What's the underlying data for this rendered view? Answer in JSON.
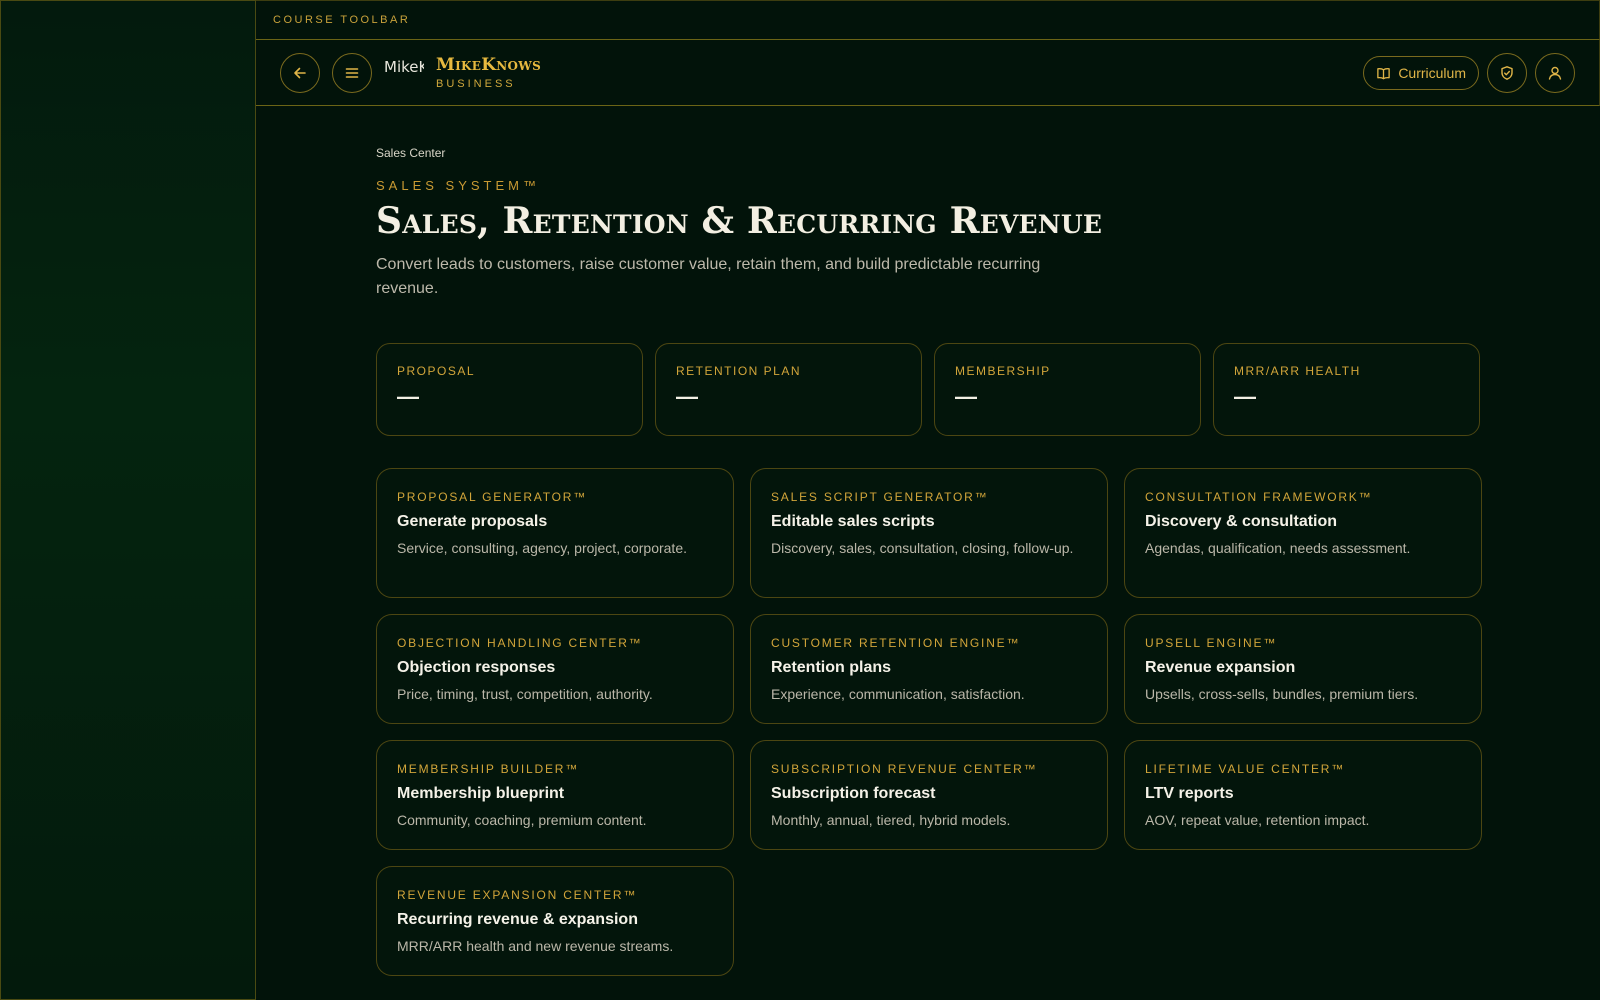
{
  "toolbar": {
    "label": "COURSE TOOLBAR"
  },
  "header": {
    "logo_alt": "MikeKnows",
    "brand_name": "MikeKnows",
    "brand_sub": "BUSINESS",
    "curriculum_label": "Curriculum",
    "icons": [
      "arrow-left-icon",
      "menu-icon",
      "book-icon",
      "shield-check-icon",
      "user-icon"
    ]
  },
  "page": {
    "breadcrumb": "Sales Center",
    "eyebrow": "SALES SYSTEM™",
    "title": "Sales, Retention & Recurring Revenue",
    "description": "Convert leads to customers, raise customer value, retain them, and build predictable recurring revenue."
  },
  "stats": [
    {
      "label": "PROPOSAL",
      "value": "—"
    },
    {
      "label": "RETENTION PLAN",
      "value": "—"
    },
    {
      "label": "MEMBERSHIP",
      "value": "—"
    },
    {
      "label": "MRR/ARR HEALTH",
      "value": "—"
    }
  ],
  "tools": [
    {
      "eyebrow": "PROPOSAL GENERATOR™",
      "title": "Generate proposals",
      "desc": "Service, consulting, agency, project, corporate."
    },
    {
      "eyebrow": "SALES SCRIPT GENERATOR™",
      "title": "Editable sales scripts",
      "desc": "Discovery, sales, consultation, closing, follow-up."
    },
    {
      "eyebrow": "CONSULTATION FRAMEWORK™",
      "title": "Discovery & consultation",
      "desc": "Agendas, qualification, needs assessment."
    },
    {
      "eyebrow": "OBJECTION HANDLING CENTER™",
      "title": "Objection responses",
      "desc": "Price, timing, trust, competition, authority."
    },
    {
      "eyebrow": "CUSTOMER RETENTION ENGINE™",
      "title": "Retention plans",
      "desc": "Experience, communication, satisfaction."
    },
    {
      "eyebrow": "UPSELL ENGINE™",
      "title": "Revenue expansion",
      "desc": "Upsells, cross-sells, bundles, premium tiers."
    },
    {
      "eyebrow": "MEMBERSHIP BUILDER™",
      "title": "Membership blueprint",
      "desc": "Community, coaching, premium content."
    },
    {
      "eyebrow": "SUBSCRIPTION REVENUE CENTER™",
      "title": "Subscription forecast",
      "desc": "Monthly, annual, tiered, hybrid models."
    },
    {
      "eyebrow": "LIFETIME VALUE CENTER™",
      "title": "LTV reports",
      "desc": "AOV, repeat value, retention impact."
    },
    {
      "eyebrow": "REVENUE EXPANSION CENTER™",
      "title": "Recurring revenue & expansion",
      "desc": "MRR/ARR health and new revenue streams."
    }
  ],
  "colors": {
    "accent": "#e0b548",
    "background": "#02130a",
    "border": "#4c4612"
  }
}
